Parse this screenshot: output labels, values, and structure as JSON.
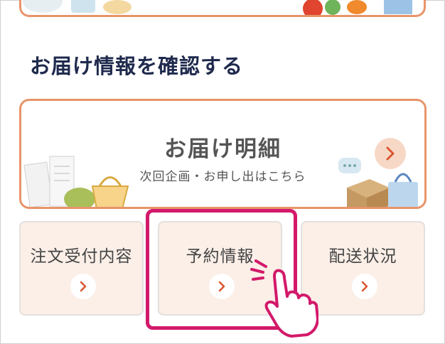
{
  "section": {
    "title": "お届け情報を確認する"
  },
  "delivery_card": {
    "title": "お届け明細",
    "subtitle": "次回企画・お申し出はこちら"
  },
  "nav": [
    {
      "label": "注文受付内容"
    },
    {
      "label": "予約情報"
    },
    {
      "label": "配送状況"
    }
  ],
  "colors": {
    "accent_orange": "#e8946a",
    "chevron": "#d9562e",
    "highlight": "#d3196a",
    "title_navy": "#1f2a4d",
    "button_bg": "#fbefe8"
  }
}
